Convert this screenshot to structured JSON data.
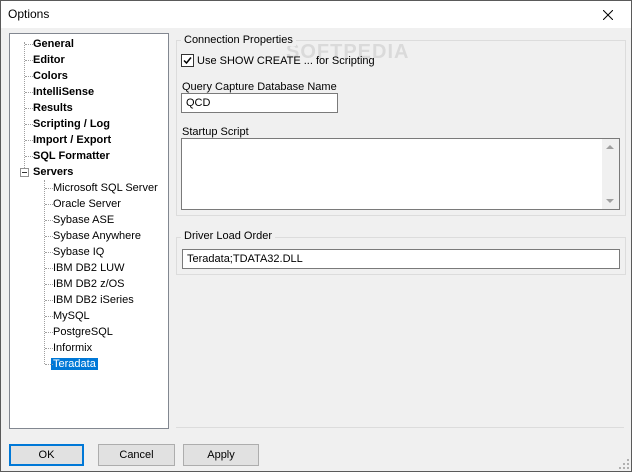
{
  "window": {
    "title": "Options"
  },
  "tree": {
    "items": [
      {
        "label": "General",
        "bold": true
      },
      {
        "label": "Editor",
        "bold": true
      },
      {
        "label": "Colors",
        "bold": true
      },
      {
        "label": "IntelliSense",
        "bold": true
      },
      {
        "label": "Results",
        "bold": true
      },
      {
        "label": "Scripting / Log",
        "bold": true
      },
      {
        "label": "Import / Export",
        "bold": true
      },
      {
        "label": "SQL Formatter",
        "bold": true
      },
      {
        "label": "Servers",
        "bold": true
      },
      {
        "label": "Microsoft SQL Server",
        "bold": false
      },
      {
        "label": "Oracle Server",
        "bold": false
      },
      {
        "label": "Sybase ASE",
        "bold": false
      },
      {
        "label": "Sybase Anywhere",
        "bold": false
      },
      {
        "label": "Sybase IQ",
        "bold": false
      },
      {
        "label": "IBM DB2 LUW",
        "bold": false
      },
      {
        "label": "IBM DB2 z/OS",
        "bold": false
      },
      {
        "label": "IBM DB2 iSeries",
        "bold": false
      },
      {
        "label": "MySQL",
        "bold": false
      },
      {
        "label": "PostgreSQL",
        "bold": false
      },
      {
        "label": "Informix",
        "bold": false
      },
      {
        "label": "Teradata",
        "bold": false,
        "selected": true
      }
    ]
  },
  "connection": {
    "group_title": "Connection Properties",
    "checkbox_label": "Use SHOW CREATE ... for Scripting",
    "checkbox_checked": true,
    "qcd_label": "Query Capture Database Name",
    "qcd_value": "QCD",
    "startup_label": "Startup Script",
    "startup_value": ""
  },
  "driver": {
    "group_title": "Driver Load Order",
    "value": "Teradata;TDATA32.DLL"
  },
  "watermark": "SOFTPEDIA",
  "buttons": {
    "ok": "OK",
    "cancel": "Cancel",
    "apply": "Apply"
  },
  "colors": {
    "selection": "#0078d7",
    "window_bg": "#f0f0f0"
  }
}
